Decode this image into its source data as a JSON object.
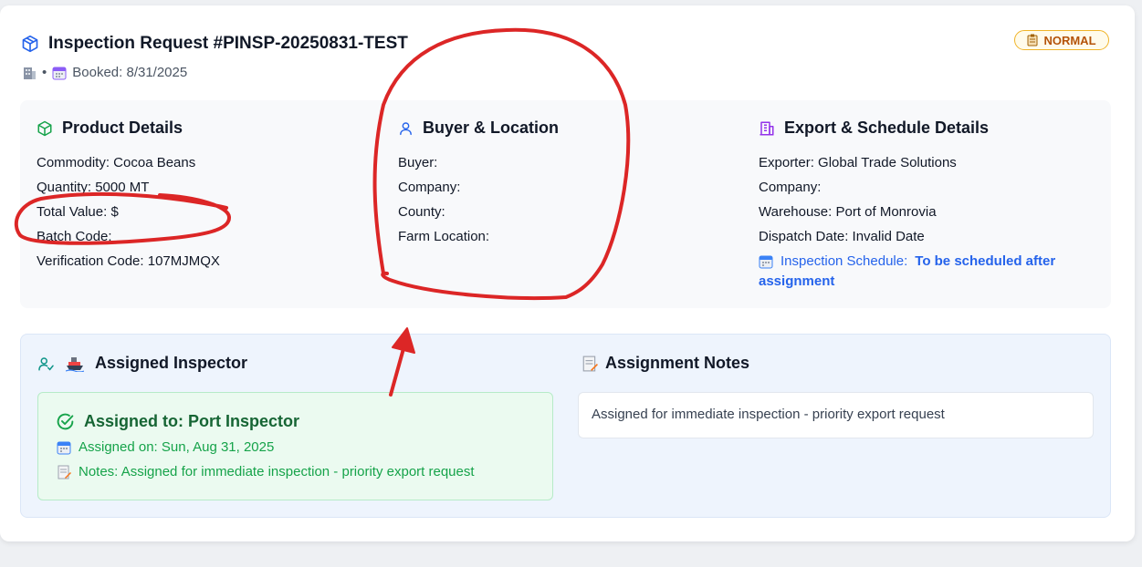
{
  "header": {
    "title": "Inspection Request #PINSP-20250831-TEST",
    "separator": "•",
    "booked": "Booked: 8/31/2025",
    "badge": "NORMAL"
  },
  "product": {
    "heading": "Product Details",
    "lines": [
      "Commodity: Cocoa Beans",
      "Quantity: 5000 MT",
      "Total Value: $",
      "Batch Code:",
      "Verification Code: 107MJMQX"
    ]
  },
  "buyer": {
    "heading": "Buyer & Location",
    "lines": [
      "Buyer:",
      "Company:",
      "County:",
      "Farm Location:"
    ]
  },
  "export": {
    "heading": "Export & Schedule Details",
    "lines": [
      "Exporter: Global Trade Solutions",
      "Company:",
      "Warehouse: Port of Monrovia",
      "Dispatch Date: Invalid Date"
    ],
    "schedule_label": "Inspection Schedule:",
    "schedule_value_1": "To be scheduled after",
    "schedule_value_2": "assignment"
  },
  "assignment": {
    "inspector_heading": "Assigned Inspector",
    "assigned_to": "Assigned to: Port Inspector",
    "assigned_on": "Assigned on: Sun, Aug 31, 2025",
    "notes_line": "Notes: Assigned for immediate inspection - priority export request",
    "notes_heading": "Assignment Notes",
    "notes_text": "Assigned for immediate inspection - priority export request"
  },
  "colors": {
    "accent_blue": "#2563eb",
    "green": "#16a34a",
    "purple": "#9333ea",
    "badge_orange": "#b45309",
    "annotation_red": "#dc2626"
  }
}
